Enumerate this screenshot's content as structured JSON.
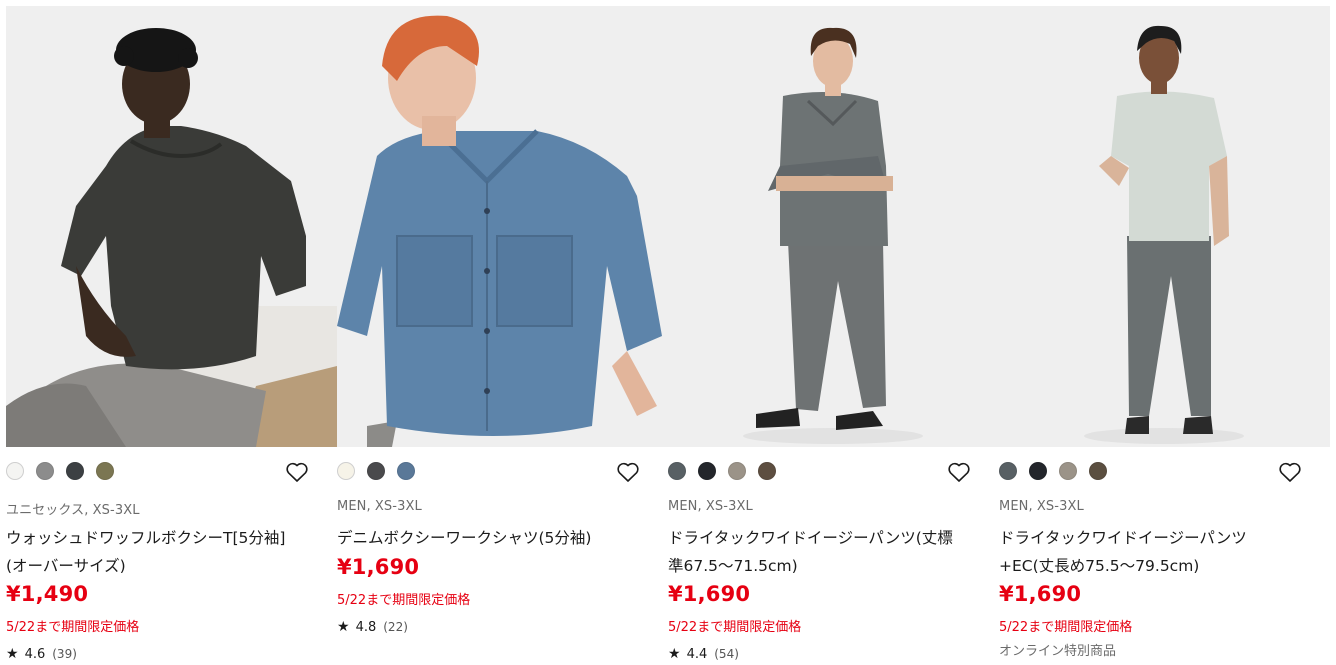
{
  "products": [
    {
      "colors": [
        "#f4f4f2",
        "#8c8c8c",
        "#3c4043",
        "#7b7652"
      ],
      "meta": "ユニセックス, XS-3XL",
      "name": "ウォッシュドワッフルボクシーT[5分袖](オーバーサイズ)",
      "price": "¥1,490",
      "promo": "5/22まで期間限定価格",
      "rating": "4.6",
      "reviews": "(39)",
      "online": ""
    },
    {
      "colors": [
        "#f6f3e8",
        "#4a4a4c",
        "#5a7898"
      ],
      "meta": "MEN, XS-3XL",
      "name": "デニムボクシーワークシャツ(5分袖)",
      "price": "¥1,690",
      "promo": "5/22まで期間限定価格",
      "rating": "4.8",
      "reviews": "(22)",
      "online": ""
    },
    {
      "colors": [
        "#586064",
        "#23262b",
        "#9b9388",
        "#5d4e40"
      ],
      "meta": "MEN, XS-3XL",
      "name": "ドライタックワイドイージーパンツ(丈標準67.5〜71.5cm)",
      "price": "¥1,690",
      "promo": "5/22まで期間限定価格",
      "rating": "4.4",
      "reviews": "(54)",
      "online": ""
    },
    {
      "colors": [
        "#586064",
        "#23262b",
        "#9b9388",
        "#5b4f40"
      ],
      "meta": "MEN, XS-3XL",
      "name": "ドライタックワイドイージーパンツ+EC(丈長め75.5〜79.5cm)",
      "price": "¥1,690",
      "promo": "5/22まで期間限定価格",
      "rating": "",
      "reviews": "",
      "online": "オンライン特別商品"
    }
  ],
  "icons": {
    "favorite": "heart-outline-icon",
    "rating": "star-icon"
  },
  "accent": "#e60012"
}
